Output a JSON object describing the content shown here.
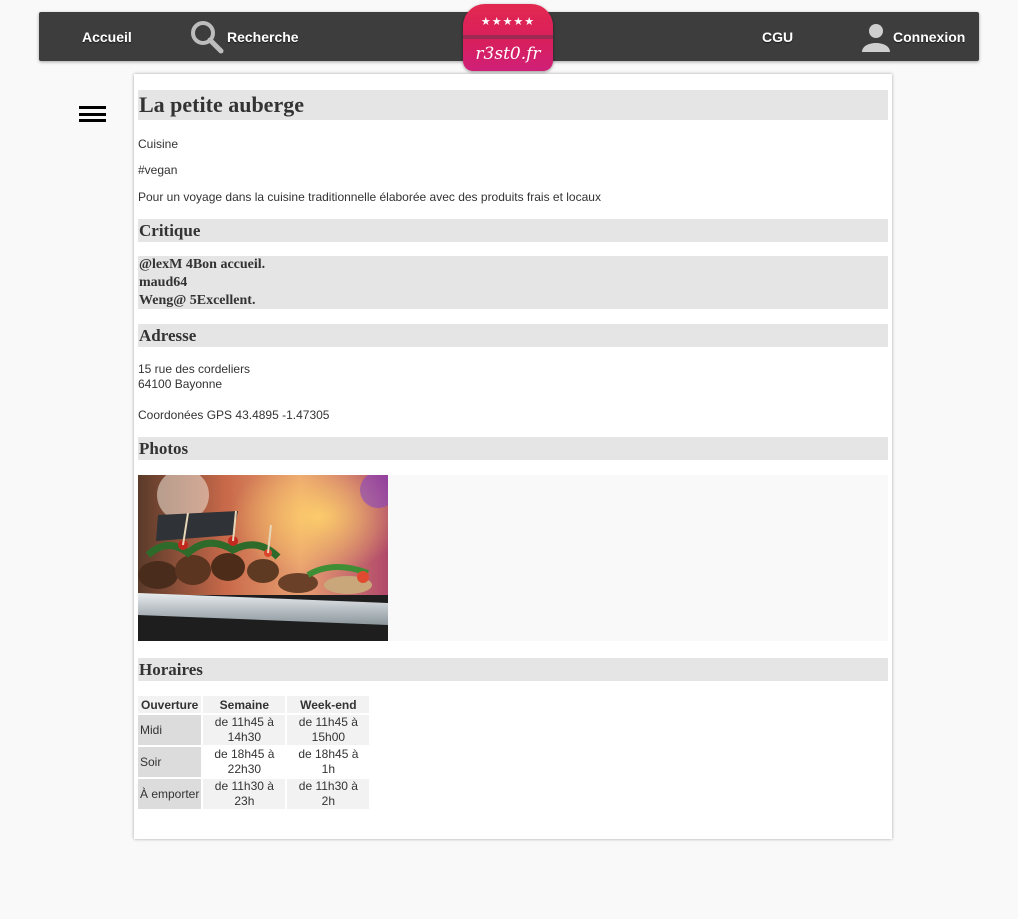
{
  "nav": {
    "accueil": "Accueil",
    "recherche": "Recherche",
    "cgu": "CGU",
    "connexion": "Connexion",
    "logo_stars": "★★★★★",
    "logo_text": "r3st0.fr",
    "search_icon": "search-icon",
    "user_icon": "user-icon"
  },
  "menu_icon": "hamburger-icon",
  "restaurant": {
    "name": "La petite auberge",
    "category": "Cuisine",
    "tag": "#vegan",
    "description": "Pour un voyage dans la cuisine traditionnelle élaborée avec des produits frais et locaux"
  },
  "critique": {
    "heading": "Critique",
    "lines": [
      "@lexM 4Bon accueil.",
      "maud64",
      "Weng@ 5Excellent."
    ]
  },
  "adresse": {
    "heading": "Adresse",
    "street": "15 rue des cordeliers",
    "city": "64100 Bayonne",
    "gps": "Coordonées GPS 43.4895 -1.47305"
  },
  "photos": {
    "heading": "Photos"
  },
  "horaires": {
    "heading": "Horaires",
    "columns": [
      "Ouverture",
      "Semaine",
      "Week-end"
    ],
    "rows": [
      [
        "Midi",
        "de 11h45 à 14h30",
        "de 11h45 à 15h00"
      ],
      [
        "Soir",
        "de 18h45 à 22h30",
        "de 18h45 à 1h"
      ],
      [
        "À emporter",
        "de 11h30 à 23h",
        "de 11h30 à 2h"
      ]
    ]
  },
  "colors": {
    "navbar": "#3d3d3d",
    "section_bg": "#e5e5e5",
    "logo_top": "#e32850",
    "logo_bottom": "#cf1f78"
  }
}
